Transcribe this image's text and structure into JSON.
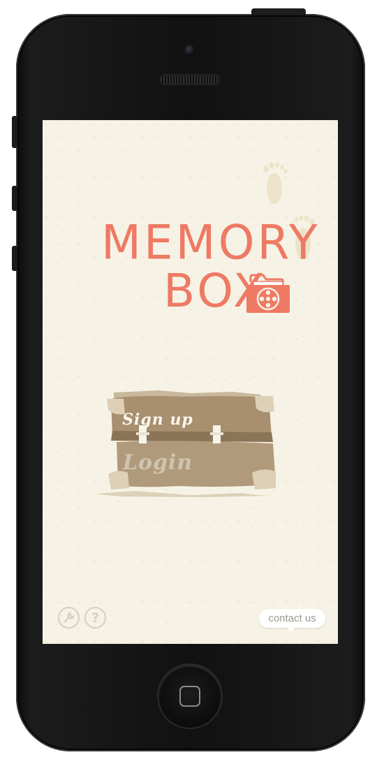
{
  "app": {
    "title_line1": "MEMORY",
    "title_line2": "BOX",
    "accent_color": "#ee7a64",
    "background_color": "#f6f3e6"
  },
  "actions": {
    "signup_label": "Sign up",
    "login_label": "Login"
  },
  "footer": {
    "contact_label": "contact us",
    "help_glyph": "?",
    "icons": [
      "settings-wrench-icon",
      "help-icon"
    ]
  },
  "decor": {
    "icons": [
      "footprint-icon",
      "folder-film-reel-icon",
      "trunk-icon"
    ]
  }
}
